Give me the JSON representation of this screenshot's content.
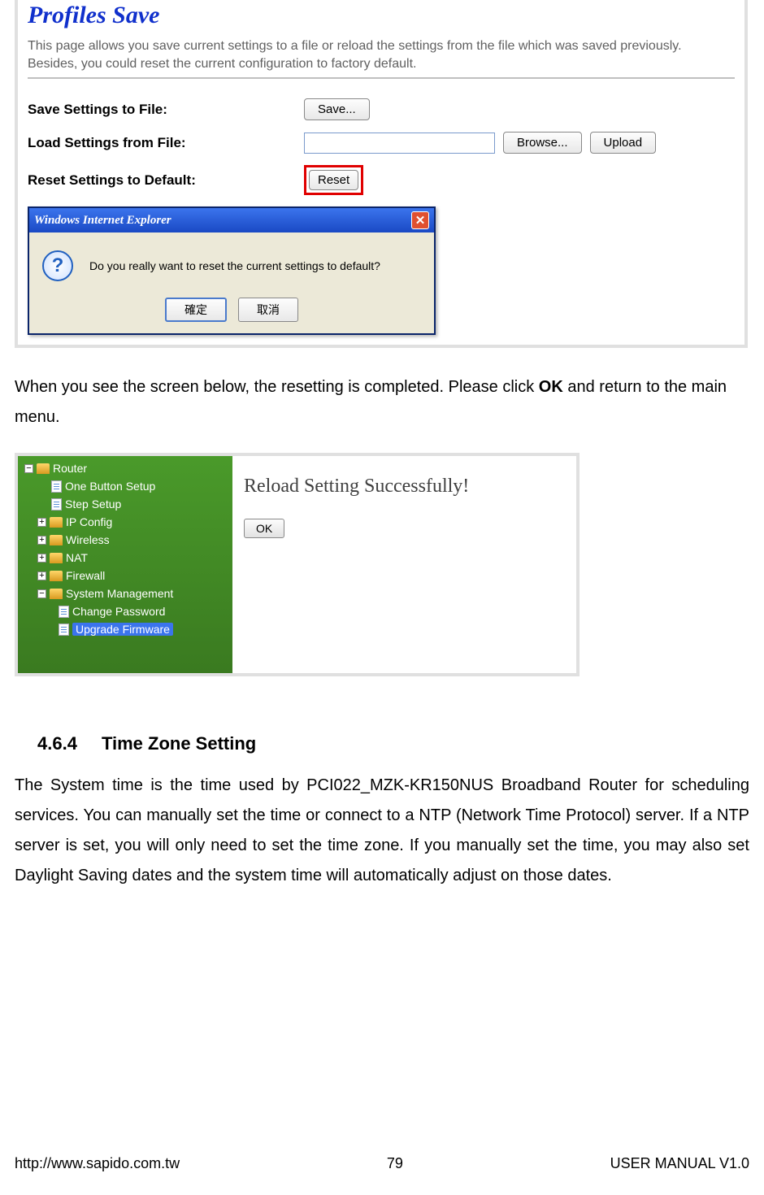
{
  "shot1": {
    "title": "Profiles Save",
    "desc": "This page allows you save current settings to a file or reload the settings from the file which was saved previously. Besides, you could reset the current configuration to factory default.",
    "rows": {
      "save_label": "Save Settings to File:",
      "save_btn": "Save...",
      "load_label": "Load Settings from File:",
      "browse_btn": "Browse...",
      "upload_btn": "Upload",
      "reset_label": "Reset Settings to Default:",
      "reset_btn": "Reset"
    },
    "dialog": {
      "title": "Windows Internet Explorer",
      "msg": "Do you really want to reset the current settings to default?",
      "ok": "確定",
      "cancel": "取消"
    }
  },
  "para1_a": "When you see the screen below, the resetting is completed. Please click ",
  "para1_b": "OK",
  "para1_c": " and return to the main menu.",
  "shot2": {
    "tree": {
      "root": "Router",
      "items": [
        "One Button Setup",
        "Step Setup",
        "IP Config",
        "Wireless",
        "NAT",
        "Firewall",
        "System Management"
      ],
      "sub": {
        "change_pw": "Change Password",
        "upgrade_fw": "Upgrade Firmware"
      }
    },
    "reload": "Reload Setting Successfully!",
    "ok": "OK"
  },
  "section": {
    "num": "4.6.4",
    "title": "Time Zone Setting",
    "body": "The System time is the time used by PCI022_MZK-KR150NUS Broadband Router for scheduling services. You can manually set the time or connect to a NTP (Network Time Protocol) server. If a NTP server is set, you will only need to set the time zone. If you manually set the time, you may also set Daylight Saving dates and the system time will automatically adjust on those dates."
  },
  "footer": {
    "url": "http://www.sapido.com.tw",
    "page": "79",
    "right": "USER MANUAL V1.0"
  }
}
